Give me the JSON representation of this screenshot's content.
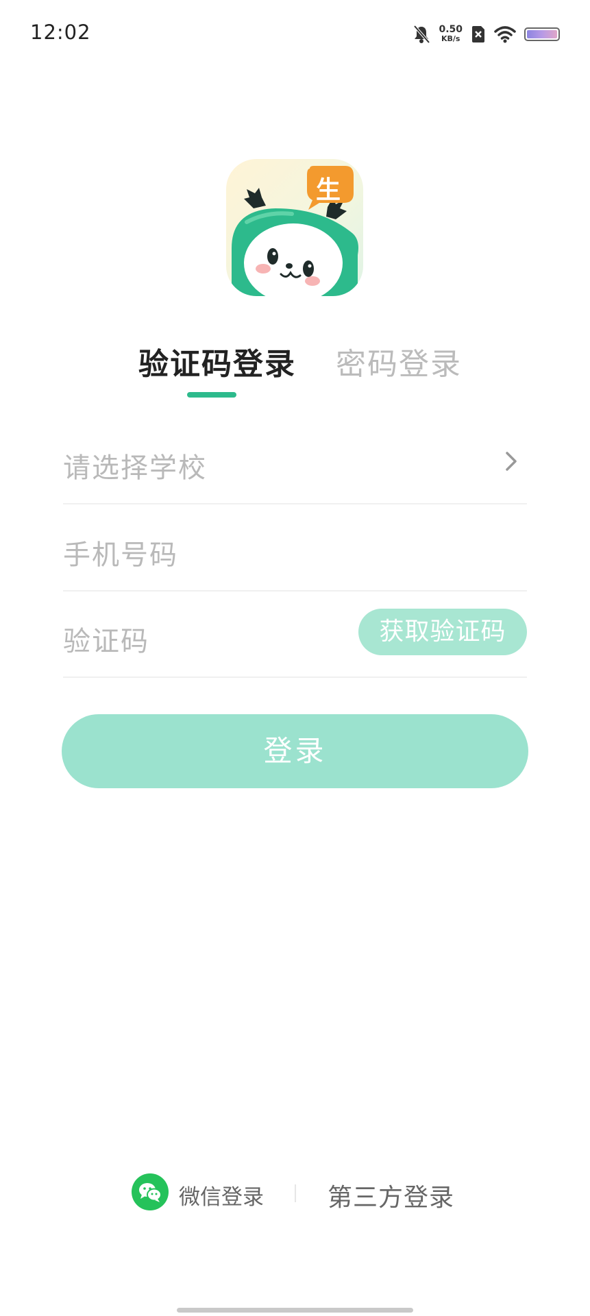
{
  "status_bar": {
    "time": "12:02",
    "net_speed_value": "0.50",
    "net_speed_unit": "KB/s",
    "icons": [
      "bell-muted-icon",
      "no-sim-icon",
      "wifi-icon",
      "battery-icon"
    ]
  },
  "logo": {
    "badge_text": "生",
    "colors": {
      "badge": "#f39a2e",
      "mascot": "#2dba8c"
    }
  },
  "tabs": [
    {
      "label": "验证码登录",
      "active": true
    },
    {
      "label": "密码登录",
      "active": false
    }
  ],
  "form": {
    "school_placeholder": "请选择学校",
    "phone_placeholder": "手机号码",
    "code_placeholder": "验证码",
    "get_code_label": "获取验证码"
  },
  "login_button_label": "登录",
  "bottom": {
    "wechat_label": "微信登录",
    "third_party_label": "第三方登录"
  },
  "colors": {
    "accent": "#2dba8c",
    "button_disabled": "#9be2ce",
    "placeholder": "#b9b9b9"
  }
}
